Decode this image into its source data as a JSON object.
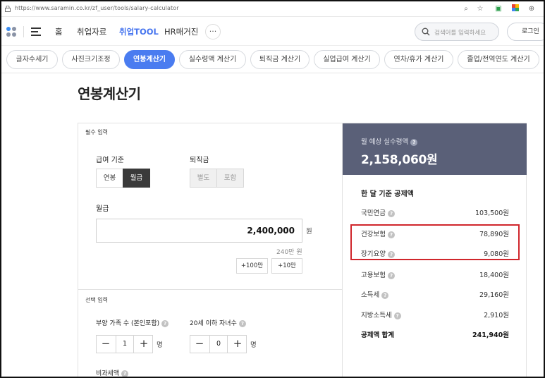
{
  "browser": {
    "url": "https://www.saramin.co.kr/zf_user/tools/salary-calculator"
  },
  "header": {
    "nav": [
      "홈",
      "취업자료",
      "취업TOOL",
      "HR매거진"
    ],
    "more_label": "···",
    "search_placeholder": "검색어를 입력하세요",
    "login_label": "로그인"
  },
  "tools_tabs": [
    {
      "label": "글자수세기",
      "active": false
    },
    {
      "label": "사진크기조정",
      "active": false
    },
    {
      "label": "연봉계산기",
      "active": true
    },
    {
      "label": "실수령액 계산기",
      "active": false
    },
    {
      "label": "퇴직금 계산기",
      "active": false
    },
    {
      "label": "실업급여 계산기",
      "active": false
    },
    {
      "label": "연차/휴가 계산기",
      "active": false
    },
    {
      "label": "졸업/전역연도 계산기",
      "active": false
    }
  ],
  "page_title": "연봉계산기",
  "form": {
    "required_label": "필수 입력",
    "pay_basis": {
      "label": "급여 기준",
      "options": [
        "연봉",
        "월급"
      ],
      "selected": "월급"
    },
    "severance": {
      "label": "퇴직금",
      "options": [
        "별도",
        "포함"
      ]
    },
    "salary": {
      "label": "월급",
      "value": "2,400,000",
      "unit": "원",
      "hint": "240만 원",
      "quick_buttons": [
        "+100만",
        "+10만"
      ]
    },
    "optional_label": "선택 입력",
    "dependents": {
      "label": "부양 가족 수 (본인포함)",
      "value": "1",
      "unit": "명"
    },
    "children": {
      "label": "20세 이하 자녀수",
      "value": "0",
      "unit": "명"
    },
    "nontax_label": "비과세액"
  },
  "result": {
    "title": "월 예상 실수령액",
    "amount": "2,158,060원",
    "deduction_title": "한 달 기준 공제액",
    "deductions": [
      {
        "label": "국민연금",
        "value": "103,500원"
      },
      {
        "label": "건강보험",
        "value": "78,890원"
      },
      {
        "label": "장기요양",
        "value": "9,080원"
      },
      {
        "label": "고용보험",
        "value": "18,400원"
      },
      {
        "label": "소득세",
        "value": "29,160원"
      },
      {
        "label": "지방소득세",
        "value": "2,910원"
      }
    ],
    "total_label": "공제액 합계",
    "total_value": "241,940원"
  },
  "colors": {
    "accent": "#4a7cf0",
    "result_header": "#5a6078",
    "highlight": "#d0262c"
  }
}
